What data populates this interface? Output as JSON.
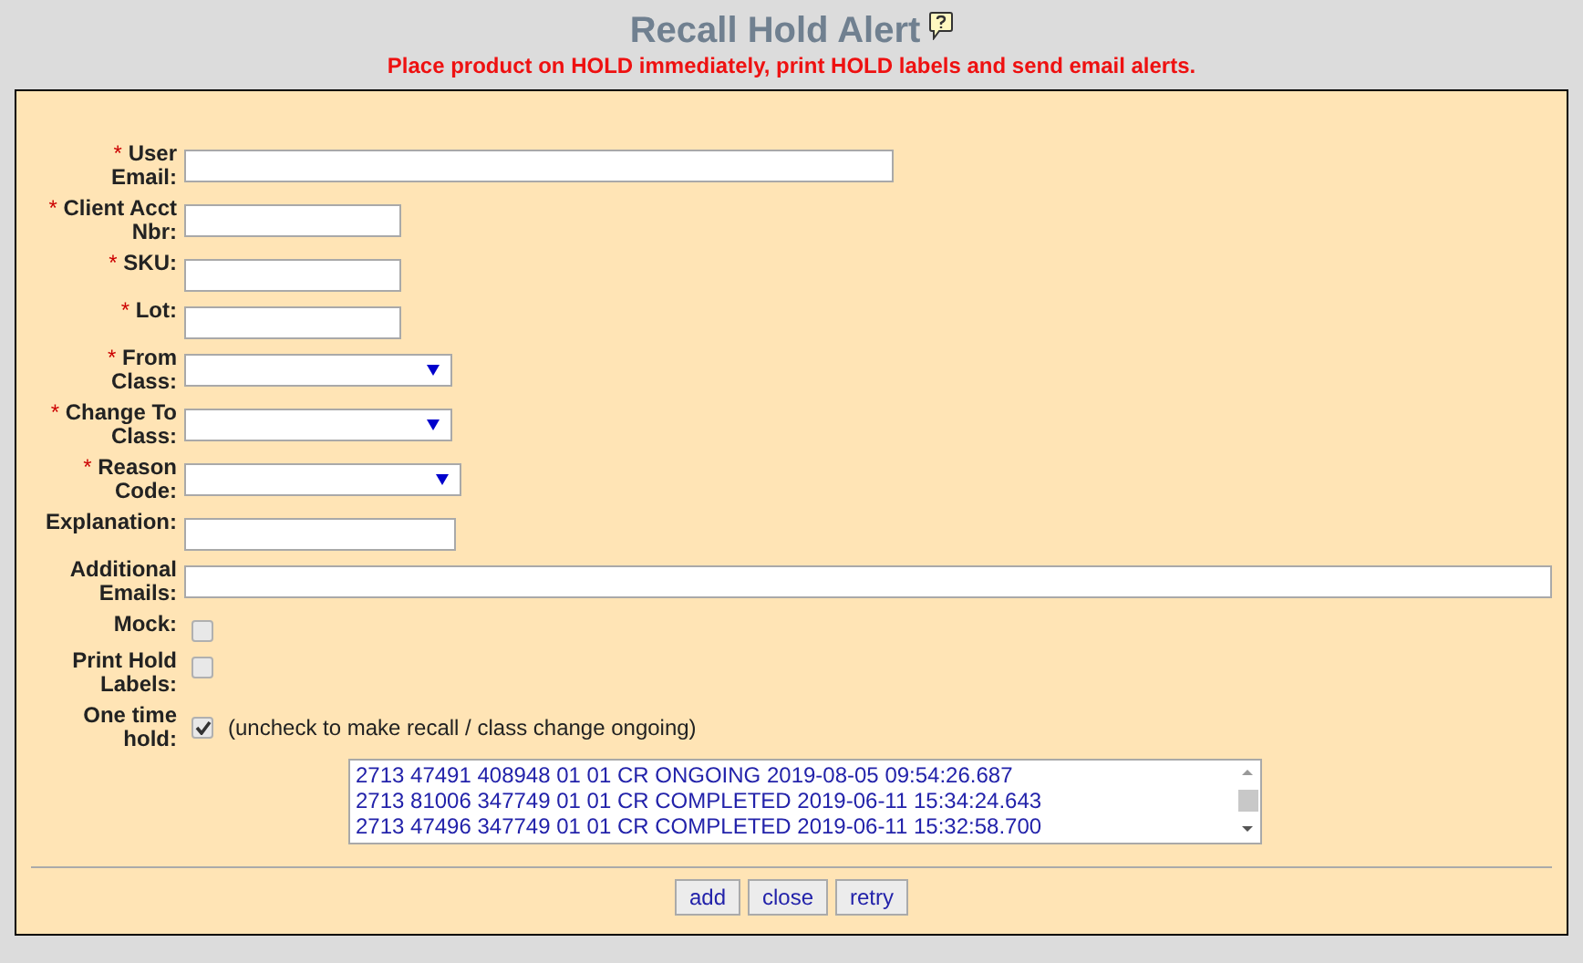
{
  "title": "Recall Hold Alert",
  "subtitle": "Place product on HOLD immediately, print HOLD labels and send email alerts.",
  "fields": [
    {
      "kind": "text",
      "mark": "*",
      "label": "User Email:"
    },
    {
      "kind": "text",
      "mark": "*",
      "label": "Client Acct Nbr:"
    },
    {
      "kind": "text",
      "mark": "*",
      "label": "SKU:"
    },
    {
      "kind": "text",
      "mark": "*",
      "label": "Lot:"
    },
    {
      "kind": "select",
      "mark": "*",
      "label": "From Class:"
    },
    {
      "kind": "select",
      "mark": "*",
      "label": "Change To Class:"
    },
    {
      "kind": "select",
      "mark": "*",
      "label": "Reason Code:"
    },
    {
      "kind": "text",
      "label": "Explanation:"
    },
    {
      "kind": "text",
      "label": "Additional Emails:"
    },
    {
      "kind": "checkbox",
      "label": "Mock:",
      "checked": false
    },
    {
      "kind": "checkbox",
      "label": "Print Hold Labels:",
      "checked": false
    },
    {
      "kind": "checkbox",
      "label": "One time hold:",
      "checked": true,
      "note": "(uncheck to make recall / class change ongoing)"
    }
  ],
  "history": [
    "2713 47491 408948 01 01 CR ONGOING 2019-08-05 09:54:26.687",
    "2713 81006 347749 01 01 CR COMPLETED 2019-06-11 15:34:24.643",
    "2713 47496 347749 01 01 CR COMPLETED 2019-06-11 15:32:58.700"
  ],
  "buttons": [
    "add",
    "close",
    "retry"
  ]
}
